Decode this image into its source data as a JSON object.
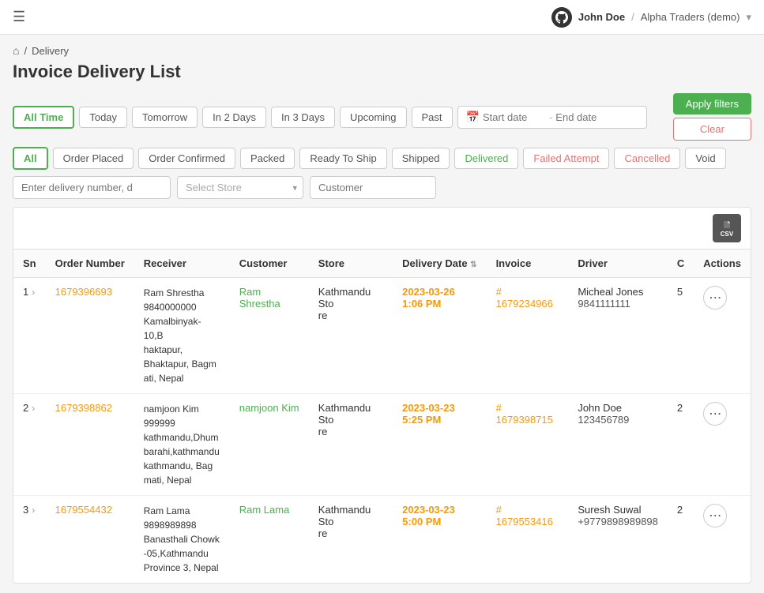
{
  "topBar": {
    "hamburgerIcon": "☰",
    "userLabel": "John Doe",
    "orgLabel": "Alpha Traders (demo)",
    "chevronIcon": "▾",
    "githubIcon": "github"
  },
  "breadcrumb": {
    "homeIcon": "⌂",
    "separator": "/",
    "section": "Delivery"
  },
  "pageTitle": "Invoice Delivery List",
  "dateFilters": [
    {
      "id": "all-time",
      "label": "All Time",
      "active": true
    },
    {
      "id": "today",
      "label": "Today",
      "active": false
    },
    {
      "id": "tomorrow",
      "label": "Tomorrow",
      "active": false
    },
    {
      "id": "in-2-days",
      "label": "In 2 Days",
      "active": false
    },
    {
      "id": "in-3-days",
      "label": "In 3 Days",
      "active": false
    },
    {
      "id": "upcoming",
      "label": "Upcoming",
      "active": false
    },
    {
      "id": "past",
      "label": "Past",
      "active": false
    }
  ],
  "dateInput": {
    "calendarIcon": "📅",
    "startPlaceholder": "Start date",
    "separator": "-",
    "endPlaceholder": "End date"
  },
  "actionButtons": {
    "applyLabel": "Apply filters",
    "clearLabel": "Clear"
  },
  "statusFilters": [
    {
      "id": "all",
      "label": "All",
      "active": true
    },
    {
      "id": "order-placed",
      "label": "Order Placed",
      "active": false
    },
    {
      "id": "order-confirmed",
      "label": "Order Confirmed",
      "active": false
    },
    {
      "id": "packed",
      "label": "Packed",
      "active": false
    },
    {
      "id": "ready-to-ship",
      "label": "Ready To Ship",
      "active": false
    },
    {
      "id": "shipped",
      "label": "Shipped",
      "active": false
    },
    {
      "id": "delivered",
      "label": "Delivered",
      "active": false,
      "color": "green"
    },
    {
      "id": "failed-attempt",
      "label": "Failed Attempt",
      "active": false,
      "color": "red"
    },
    {
      "id": "cancelled",
      "label": "Cancelled",
      "active": false,
      "color": "red"
    },
    {
      "id": "void",
      "label": "Void",
      "active": false
    }
  ],
  "searchBar": {
    "deliveryPlaceholder": "Enter delivery number, d",
    "storePlaceholder": "Select Store",
    "customerPlaceholder": "Customer"
  },
  "table": {
    "csvLabel": "CSV",
    "columns": [
      "Sn",
      "Order Number",
      "Receiver",
      "Customer",
      "Store",
      "Delivery Date",
      "Invoice",
      "Driver",
      "C",
      "Actions"
    ],
    "rows": [
      {
        "sn": 1,
        "orderNumber": "1679396693",
        "receiver": "Ram Shrestha\n9840000000\nKamalbinyak-10,B\nhaktapur,\nBhaktapur, Bagm\nati, Nepal",
        "customer": "Ram Shrestha",
        "store": "Kathmandu Sto\nre",
        "deliveryDate": "2023-03-26",
        "deliveryTime": "1:06 PM",
        "invoice": "# 1679234966",
        "driverName": "Micheal Jones",
        "driverPhone": "9841111111",
        "c": "5"
      },
      {
        "sn": 2,
        "orderNumber": "1679398862",
        "receiver": "namjoon Kim\n999999\nkathmandu,Dhum\nbarahi,kathmandu\nkathmandu, Bag\nmati, Nepal",
        "customer": "namjoon Kim",
        "store": "Kathmandu Sto\nre",
        "deliveryDate": "2023-03-23",
        "deliveryTime": "5:25 PM",
        "invoice": "# 1679398715",
        "driverName": "John Doe",
        "driverPhone": "123456789",
        "c": "2"
      },
      {
        "sn": 3,
        "orderNumber": "1679554432",
        "receiver": "Ram Lama\n9898989898\nBanasthali Chowk\n-05,Kathmandu\nProvince 3, Nepal",
        "customer": "Ram Lama",
        "store": "Kathmandu Sto\nre",
        "deliveryDate": "2023-03-23",
        "deliveryTime": "5:00 PM",
        "invoice": "# 1679553416",
        "driverName": "Suresh Suwal",
        "driverPhone": "+9779898989898",
        "c": "2"
      }
    ]
  }
}
